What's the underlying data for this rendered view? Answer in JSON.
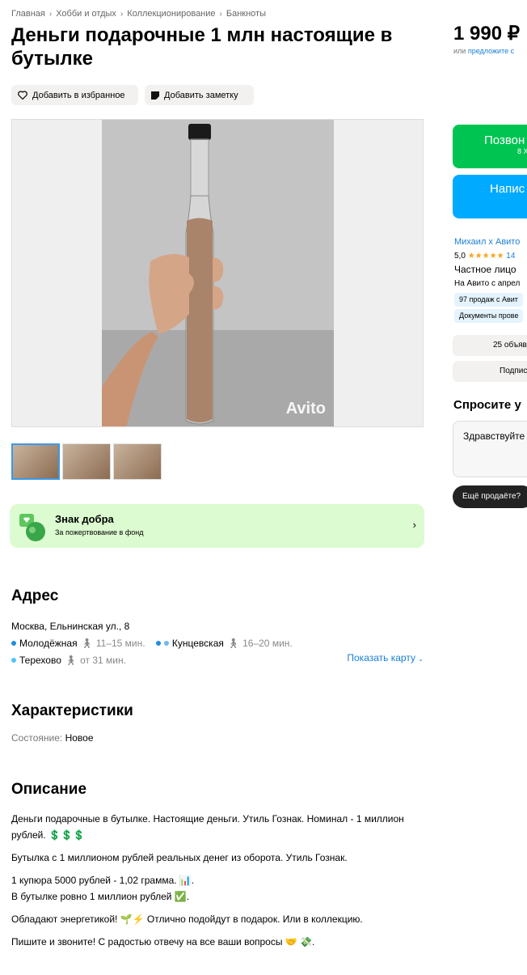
{
  "breadcrumbs": [
    "Главная",
    "Хобби и отдых",
    "Коллекционирование",
    "Банкноты"
  ],
  "title": "Деньги подарочные 1 млн настоящие в бутылке",
  "actions": {
    "favorite": "Добавить в избранное",
    "note": "Добавить заметку"
  },
  "gallery": {
    "watermark": "Avito",
    "thumbnail_count": 3
  },
  "charity": {
    "title": "Знак добра",
    "subtitle": "За пожертвование в фонд"
  },
  "address": {
    "heading": "Адрес",
    "line": "Москва, Ельнинская ул., 8",
    "metro": [
      {
        "name": "Молодёжная",
        "time": "11–15 мин.",
        "color": "#1d8ee1"
      },
      {
        "name": "Кунцевская",
        "time": "16–20 мин.",
        "color": "#1d8ee1"
      },
      {
        "name": "Терехово",
        "time": "от 31 мин.",
        "color": "#4fc3f7"
      }
    ],
    "show_map": "Показать карту"
  },
  "characteristics": {
    "heading": "Характеристики",
    "state_label": "Состояние:",
    "state_value": "Новое"
  },
  "description": {
    "heading": "Описание",
    "p1": "Деньги подарочные в бутылке. Настоящие деньги. Утиль Гознак. Номинал - 1 миллион рублей. 💲💲💲",
    "p2": "Бутылка с 1 миллионом рублей реальных денег из оборота. Утиль Гознак.",
    "p3a": "1 купюра 5000 рублей - 1,02 грамма. 📊.",
    "p3b": "В бутылке ровно 1 миллион рублей ✅.",
    "p4": "Обладают энергетикой! 🌱⚡ Отлично подойдут в подарок. Или в коллекцию.",
    "p5": "Пишите и звоните! С радостью отвечу на все ваши вопросы 🤝 💸."
  },
  "sidebar": {
    "price": "1 990 ₽",
    "offer_prefix": "или",
    "offer_link": "предложите с",
    "call": "Позвон",
    "call_sub": "8 Х",
    "write": "Напис",
    "seller_name": "Михаил х Авито",
    "rating": "5,0",
    "stars": "★★★★★",
    "reviews": "14",
    "seller_type": "Частное лицо",
    "since": "На Авито с апрел",
    "sales": "97 продаж с Авит",
    "docs": "Документы прове",
    "ads_btn": "25 объяв",
    "subscribe_btn": "Подпис",
    "ask_heading": "Спросите у",
    "ask_placeholder": "Здравствуйте",
    "ask_chip": "Ещё продаёте?"
  },
  "colors": {
    "accent_link": "#1a7fd6",
    "call_green": "#00c452",
    "write_blue": "#00aaff",
    "charity_bg": "#dcfbd0"
  }
}
